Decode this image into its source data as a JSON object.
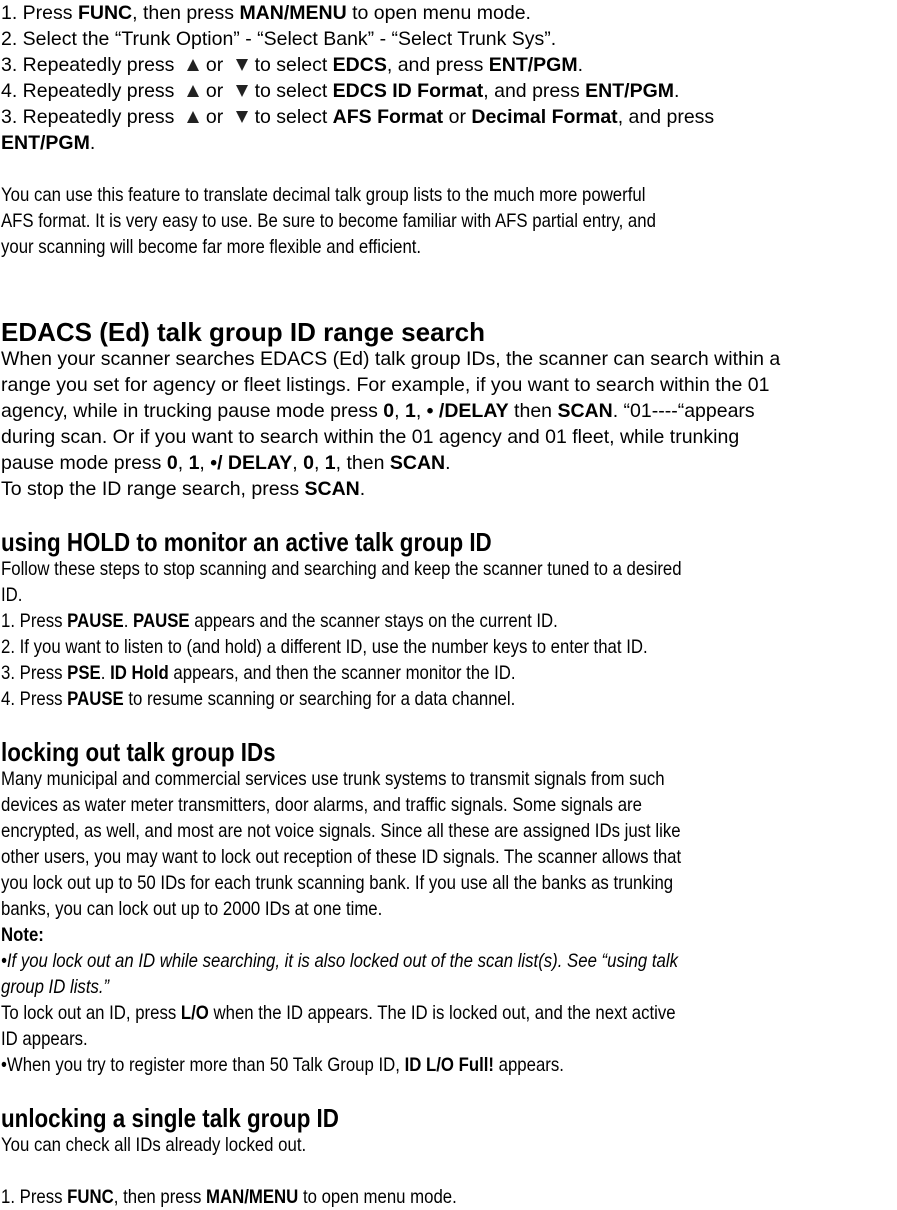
{
  "intro_steps": {
    "s1": {
      "a": "1. Press ",
      "b1": "FUNC",
      "c": ", then press ",
      "b2": "MAN/MENU",
      "d": " to open menu mode."
    },
    "s2": {
      "a": "2. Select the “Trunk Option” - “Select Bank” - “Select Trunk Sys”."
    },
    "s3": {
      "a": "3. Repeatedly press",
      "or": "or",
      "c": "to select ",
      "b1": "EDCS",
      "d": ", and press ",
      "b2": "ENT/PGM",
      "e": "."
    },
    "s4": {
      "a": "4. Repeatedly press",
      "or": "or",
      "c": "to select ",
      "b1": "EDCS ID Format",
      "d": ", and press ",
      "b2": "ENT/PGM",
      "e": "."
    },
    "s5": {
      "a": "3. Repeatedly press",
      "or": "or",
      "c": "to select ",
      "b1": "AFS Format",
      "d": " or ",
      "b2": "Decimal Format",
      "e": ", and press",
      "b3": "ENT/PGM",
      "f": "."
    }
  },
  "icons": {
    "up": "up-arrow-key-icon",
    "down": "down-arrow-key-icon"
  },
  "intro_para": [
    "You can use this feature to translate decimal talk group lists to the much more powerful",
    "AFS format. It is very easy to use. Be sure to become familiar with AFS partial entry, and",
    "your scanning will become far more flexible and efficient."
  ],
  "edacs": {
    "heading": "EDACS (Ed) talk group ID range search",
    "l1": "When your scanner searches EDACS (Ed) talk group IDs, the scanner can search within a",
    "l2": "range you set for agency or fleet listings. For example, if you want to search within the 01",
    "l3": {
      "a": "agency, while in trucking pause mode press ",
      "b1": "0",
      "c": ", ",
      "b2": "1",
      "d": ", ",
      "b3": "• /DELAY",
      "e": " then ",
      "b4": "SCAN",
      "f": ". “01----“appears"
    },
    "l4": "during scan. Or if you want to search within the 01 agency and 01 fleet, while trunking",
    "l5": {
      "a": "pause mode press ",
      "b1": "0",
      "c": ", ",
      "b2": "1",
      "d": ", ",
      "b3": "•/ DELAY",
      "e": ", ",
      "b4": "0",
      "f": ", ",
      "b5": "1",
      "g": ", then ",
      "b6": "SCAN",
      "h": "."
    },
    "l6": {
      "a": "To stop the ID range search, press ",
      "b1": "SCAN",
      "c": "."
    }
  },
  "hold": {
    "heading": "using HOLD to monitor an active talk group ID",
    "l1": "Follow these steps to stop scanning and searching and keep the scanner tuned to a desired",
    "l2": "ID.",
    "l3": {
      "a": "1. Press ",
      "b1": "PAUSE",
      "c": ". ",
      "b2": "PAUSE",
      "d": " appears and the scanner stays on the current ID."
    },
    "l4": "2. If you want to listen to (and hold) a different ID, use the number keys to enter that ID.",
    "l5": {
      "a": "3. Press ",
      "b1": "PSE",
      "c": ". ",
      "b2": "ID Hold",
      "d": " appears, and then the scanner monitor the ID."
    },
    "l6": {
      "a": "4. Press ",
      "b1": "PAUSE",
      "c": " to resume scanning or searching for a data channel."
    }
  },
  "lockout": {
    "heading": "locking out talk group IDs",
    "para": [
      "Many municipal and commercial services use trunk systems to transmit signals from such",
      "devices as water meter transmitters, door alarms, and traffic signals. Some signals are",
      "encrypted, as well, and most are not voice signals. Since all these are assigned IDs just like",
      "other users, you may want to lock out reception of these ID signals. The scanner allows that",
      "you lock out up to 50 IDs for each trunk scanning bank. If you use all the banks as trunking",
      "banks, you can lock out up to 2000 IDs at one time."
    ],
    "note_label": "Note:",
    "note1a": "•If you lock out an ID while searching, it is also locked out of the scan list(s). See “using talk",
    "note1b": "group ID lists.”",
    "l_lo1": {
      "a": "To lock out an ID, press ",
      "b1": "L/O",
      "c": " when the ID appears. The ID is locked out, and the next active"
    },
    "l_lo2": "ID appears.",
    "l_full": {
      "a": "•When you try to register more than 50 Talk Group ID, ",
      "b1": "ID L/O Full!",
      "c": " appears."
    }
  },
  "unlock": {
    "heading": "unlocking a single talk group ID",
    "l1": "You can check all IDs already locked out.",
    "s1": {
      "a": "1. Press ",
      "b1": "FUNC",
      "c": ", then press ",
      "b2": "MAN/MENU",
      "d": " to open menu mode."
    }
  }
}
